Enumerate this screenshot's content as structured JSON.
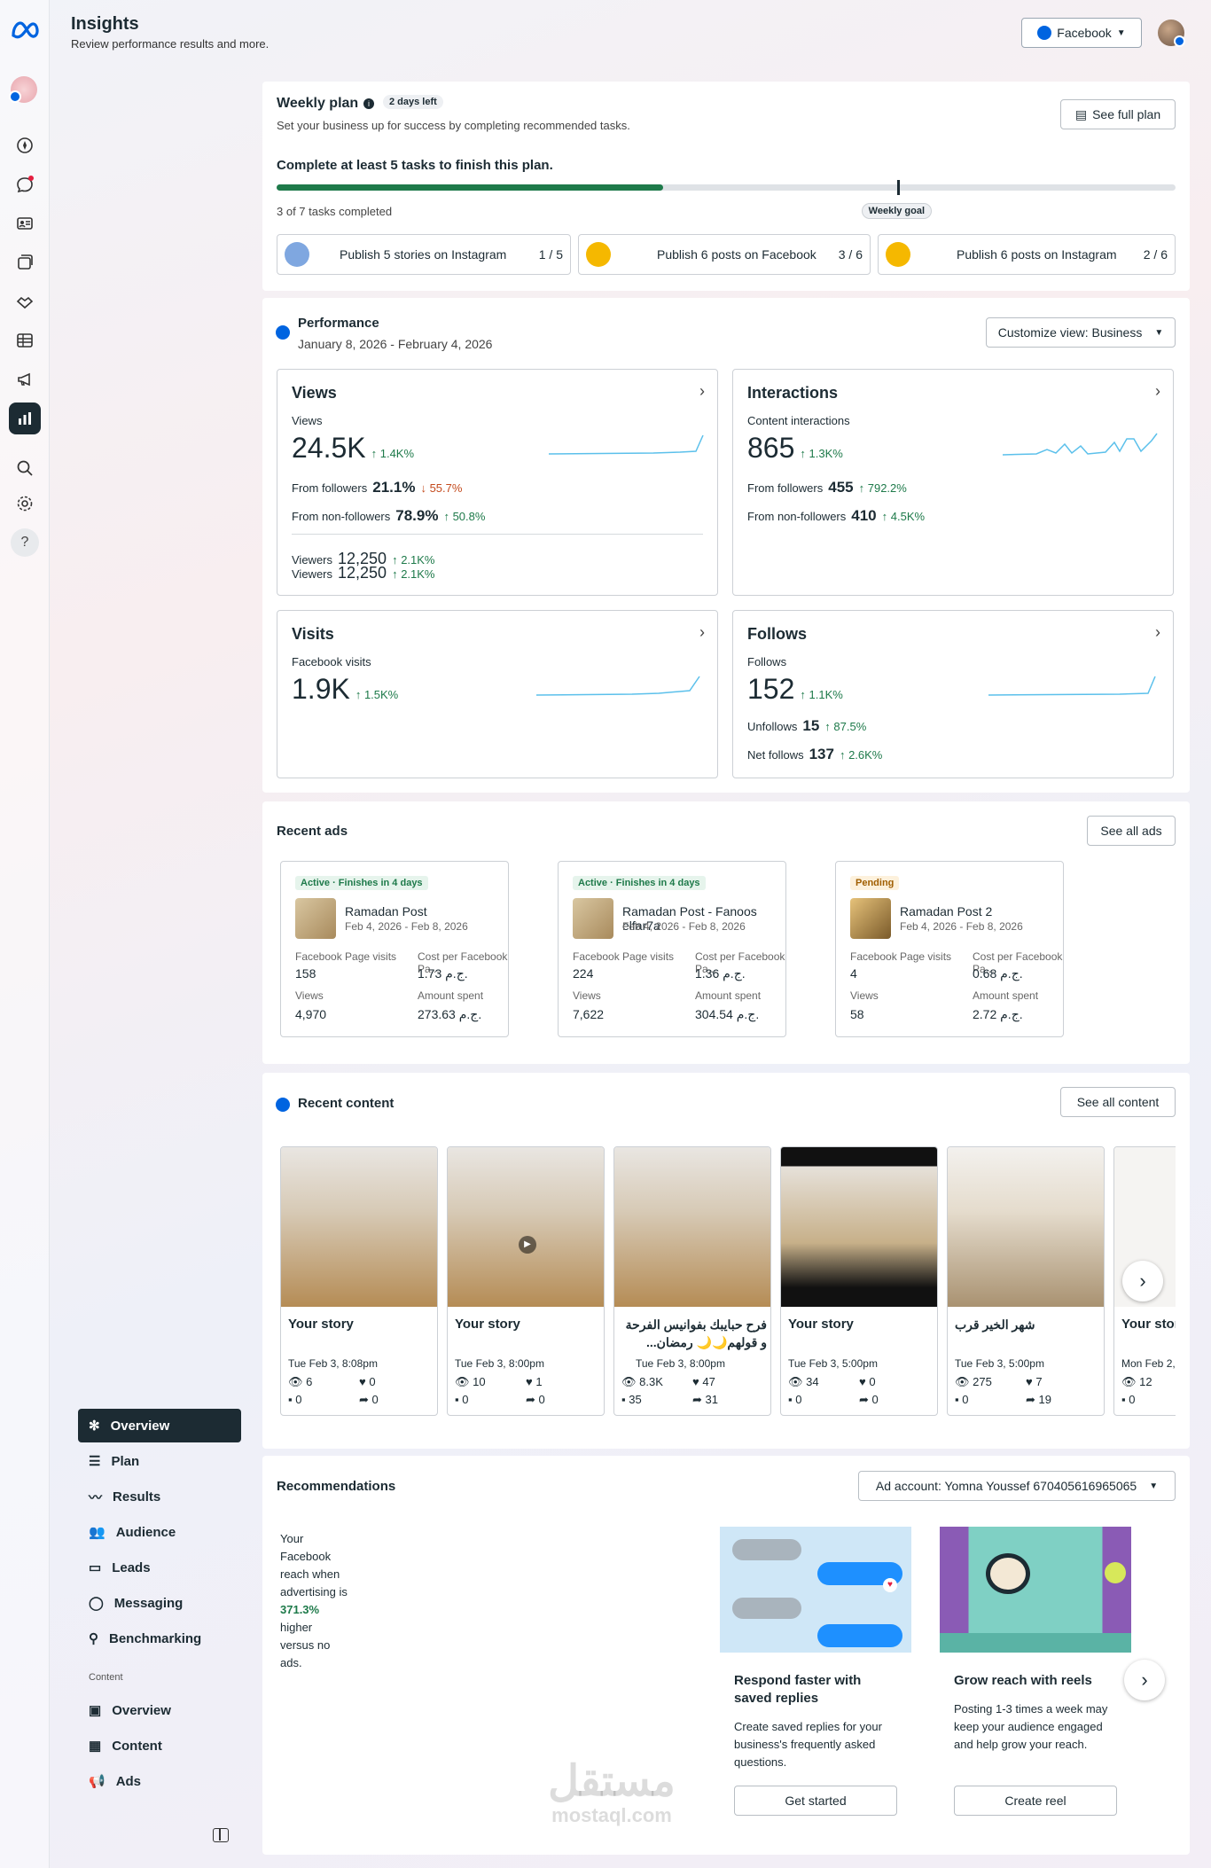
{
  "header": {
    "title": "Insights",
    "subtitle": "Review performance results and more.",
    "platform_select": "Facebook"
  },
  "weekly_plan": {
    "title": "Weekly plan",
    "days_left": "2 days left",
    "subtitle": "Set your business up for success by completing recommended tasks.",
    "see_full_plan": "See full plan",
    "goal_text": "Complete at least 5 tasks to finish this plan.",
    "progress_fraction": 0.43,
    "goal_marker_fraction": 0.69,
    "completed_text": "3 of 7 tasks completed",
    "goal_label": "Weekly goal",
    "tasks": [
      {
        "label": "Publish 5 stories on Instagram",
        "count": "1 / 5"
      },
      {
        "label": "Publish 6 posts on Facebook",
        "count": "3 / 6"
      },
      {
        "label": "Publish 6 posts on Instagram",
        "count": "2 / 6"
      }
    ]
  },
  "performance": {
    "title": "Performance",
    "date_range": "January 8, 2026 - February 4, 2026",
    "customize": "Customize view: Business",
    "views": {
      "title": "Views",
      "label": "Views",
      "value": "24.5K",
      "change": "↑ 1.4K%",
      "followers_label": "From followers",
      "followers_value": "21.1%",
      "followers_change": "↓ 55.7%",
      "nonfollowers_label": "From non-followers",
      "nonfollowers_value": "78.9%",
      "nonfollowers_change": "↑ 50.8%",
      "viewers_label": "Viewers",
      "viewers_value": "12,250",
      "viewers_change": "↑ 2.1K%"
    },
    "interactions": {
      "title": "Interactions",
      "label": "Content interactions",
      "value": "865",
      "change": "↑ 1.3K%",
      "followers_label": "From followers",
      "followers_value": "455",
      "followers_change": "↑ 792.2%",
      "nonfollowers_label": "From non-followers",
      "nonfollowers_value": "410",
      "nonfollowers_change": "↑ 4.5K%"
    },
    "visits": {
      "title": "Visits",
      "label": "Facebook visits",
      "value": "1.9K",
      "change": "↑ 1.5K%"
    },
    "follows": {
      "title": "Follows",
      "label": "Follows",
      "value": "152",
      "change": "↑ 1.1K%",
      "unfollows_label": "Unfollows",
      "unfollows_value": "15",
      "unfollows_change": "↑ 87.5%",
      "net_label": "Net follows",
      "net_value": "137",
      "net_change": "↑ 2.6K%"
    }
  },
  "recent_ads": {
    "title": "Recent ads",
    "see_all": "See all ads",
    "k1": "Facebook Page visits",
    "k2": "Cost per Facebook Pa...",
    "k3": "Views",
    "k4": "Amount spent",
    "ads": [
      {
        "status": "Active · Finishes in 4 days",
        "name": "Ramadan Post",
        "dates": "Feb 4, 2026 - Feb 8, 2026",
        "visits": "158",
        "cpv": "1.73 ج.م.",
        "views": "4,970",
        "spent": "273.63 ج.م."
      },
      {
        "status": "Active · Finishes in 4 days",
        "name": "Ramadan Post - Fanoos elfar7a",
        "dates": "Feb 4, 2026 - Feb 8, 2026",
        "visits": "224",
        "cpv": "1.36 ج.م.",
        "views": "7,622",
        "spent": "304.54 ج.م."
      },
      {
        "status": "Pending",
        "name": "Ramadan Post 2",
        "dates": "Feb 4, 2026 - Feb 8, 2026",
        "visits": "4",
        "cpv": "0.68 ج.م.",
        "views": "58",
        "spent": "2.72 ج.م."
      }
    ]
  },
  "recent_content": {
    "title": "Recent content",
    "see_all": "See all content",
    "posts": [
      {
        "caption": "Your story",
        "time": "Tue Feb 3, 8:08pm",
        "views": "6",
        "likes": "0",
        "comments": "0",
        "shares": "0"
      },
      {
        "caption": "Your story",
        "time": "Tue Feb 3, 8:00pm",
        "views": "10",
        "likes": "1",
        "comments": "0",
        "shares": "0"
      },
      {
        "caption": "فرح حبايبك بفوانيس الفرحة و قولهم🌙🌙 رمضان...",
        "time": "Tue Feb 3, 8:00pm",
        "views": "8.3K",
        "likes": "47",
        "comments": "35",
        "shares": "31"
      },
      {
        "caption": "Your story",
        "time": "Tue Feb 3, 5:00pm",
        "views": "34",
        "likes": "0",
        "comments": "0",
        "shares": "0"
      },
      {
        "caption": "شهر الخير قرب",
        "time": "Tue Feb 3, 5:00pm",
        "views": "275",
        "likes": "7",
        "comments": "0",
        "shares": "19"
      },
      {
        "caption": "Your stor",
        "time": "Mon Feb 2,",
        "views": "12",
        "likes": "",
        "comments": "0",
        "shares": ""
      }
    ]
  },
  "recommendations": {
    "title": "Recommendations",
    "ad_account": "Ad account: Yomna Youssef 670405616965065",
    "reach_text_1": "Your Facebook reach when advertising is ",
    "reach_value": "371.3%",
    "reach_text_2": " higher versus no ads.",
    "cards": [
      {
        "title": "Respond faster with saved replies",
        "desc": "Create saved replies for your business's frequently asked questions.",
        "button": "Get started"
      },
      {
        "title": "Grow reach with reels",
        "desc": "Posting 1-3 times a week may keep your audience engaged and help grow your reach.",
        "button": "Create reel"
      }
    ]
  },
  "sidebar": {
    "items": [
      "Overview",
      "Plan",
      "Results",
      "Audience",
      "Leads",
      "Messaging",
      "Benchmarking"
    ],
    "content_header": "Content",
    "content_items": [
      "Overview",
      "Content",
      "Ads"
    ]
  },
  "watermark": {
    "brand": "مستقل",
    "domain": "mostaql.com"
  },
  "colors": {
    "accent": "#0064e0",
    "progress": "#1e7a4a",
    "sparkline": "#5bc0eb",
    "nav_active": "#1c2b33"
  }
}
